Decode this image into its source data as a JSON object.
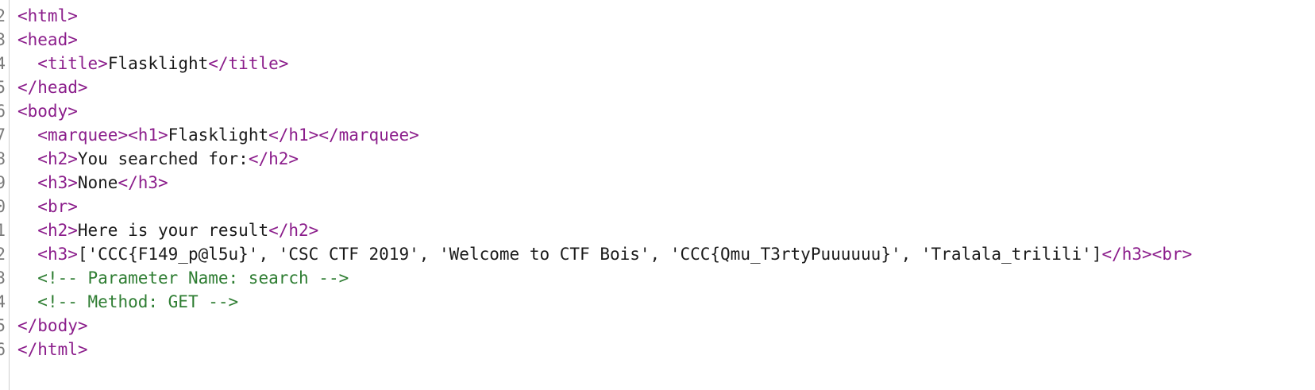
{
  "colors": {
    "tag": "#8b1d8b",
    "text": "#1a1a1a",
    "comment": "#2e7d32",
    "gutter_text": "#7a7a7a",
    "background": "#ffffff"
  },
  "gutter": [
    "2",
    "3",
    "4",
    "5",
    "6",
    "7",
    "8",
    "9",
    "0",
    "1",
    "2",
    "3",
    "4",
    "5",
    "6"
  ],
  "lines": [
    [
      {
        "t": "tag",
        "v": "<html>"
      }
    ],
    [
      {
        "t": "tag",
        "v": "<head>"
      }
    ],
    [
      {
        "t": "txt",
        "v": "  "
      },
      {
        "t": "tag",
        "v": "<title>"
      },
      {
        "t": "txt",
        "v": "Flasklight"
      },
      {
        "t": "tag",
        "v": "</title>"
      }
    ],
    [
      {
        "t": "tag",
        "v": "</head>"
      }
    ],
    [
      {
        "t": "tag",
        "v": "<body>"
      }
    ],
    [
      {
        "t": "txt",
        "v": "  "
      },
      {
        "t": "tag",
        "v": "<marquee><h1>"
      },
      {
        "t": "txt",
        "v": "Flasklight"
      },
      {
        "t": "tag",
        "v": "</h1></marquee>"
      }
    ],
    [
      {
        "t": "txt",
        "v": "  "
      },
      {
        "t": "tag",
        "v": "<h2>"
      },
      {
        "t": "txt",
        "v": "You searched for:"
      },
      {
        "t": "tag",
        "v": "</h2>"
      }
    ],
    [
      {
        "t": "txt",
        "v": "  "
      },
      {
        "t": "tag",
        "v": "<h3>"
      },
      {
        "t": "txt",
        "v": "None"
      },
      {
        "t": "tag",
        "v": "</h3>"
      }
    ],
    [
      {
        "t": "txt",
        "v": "  "
      },
      {
        "t": "tag",
        "v": "<br>"
      }
    ],
    [
      {
        "t": "txt",
        "v": "  "
      },
      {
        "t": "tag",
        "v": "<h2>"
      },
      {
        "t": "txt",
        "v": "Here is your result"
      },
      {
        "t": "tag",
        "v": "</h2>"
      }
    ],
    [
      {
        "t": "txt",
        "v": "  "
      },
      {
        "t": "tag",
        "v": "<h3>"
      },
      {
        "t": "txt",
        "v": "['CCC{F149_p@l5u}', 'CSC CTF 2019', 'Welcome to CTF Bois', 'CCC{Qmu_T3rtyPuuuuuu}', 'Tralala_trilili']"
      },
      {
        "t": "tag",
        "v": "</h3><br>"
      }
    ],
    [
      {
        "t": "txt",
        "v": "  "
      },
      {
        "t": "cmt",
        "v": "<!-- Parameter Name: search -->"
      }
    ],
    [
      {
        "t": "txt",
        "v": "  "
      },
      {
        "t": "cmt",
        "v": "<!-- Method: GET -->"
      }
    ],
    [
      {
        "t": "tag",
        "v": "</body>"
      }
    ],
    [
      {
        "t": "tag",
        "v": "</html>"
      }
    ]
  ]
}
